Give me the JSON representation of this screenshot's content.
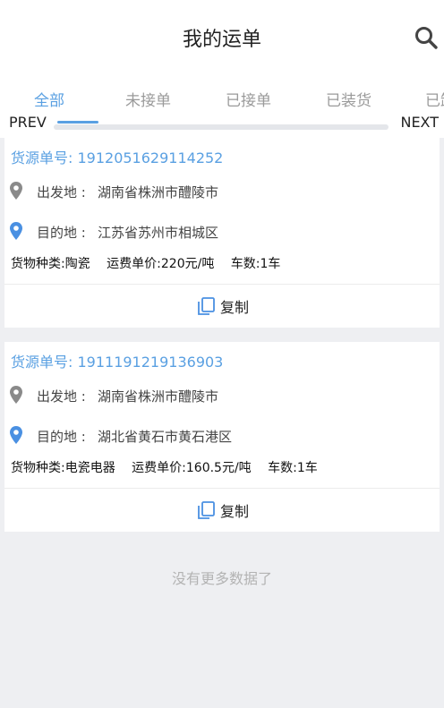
{
  "header": {
    "title": "我的运单"
  },
  "tabs": [
    {
      "label": "全部",
      "active": true
    },
    {
      "label": "未接单",
      "active": false
    },
    {
      "label": "已接单",
      "active": false
    },
    {
      "label": "已装货",
      "active": false
    },
    {
      "label": "已卸",
      "active": false
    }
  ],
  "nav": {
    "prev": "PREV",
    "next": "NEXT"
  },
  "orders": [
    {
      "order_no": "货源单号: 1912051629114252",
      "from_label": "出发地 :",
      "from_value": "湖南省株洲市醴陵市",
      "to_label": "目的地 :",
      "to_value": "江苏省苏州市相城区",
      "cargo_type": "货物种类:陶瓷",
      "unit_price": "运费单价:220元/吨",
      "truck_count": "车数:1车",
      "copy_label": "复制"
    },
    {
      "order_no": "货源单号: 1911191219136903",
      "from_label": "出发地 :",
      "from_value": "湖南省株洲市醴陵市",
      "to_label": "目的地 :",
      "to_value": "湖北省黄石市黄石港区",
      "cargo_type": "货物种类:电瓷电器",
      "unit_price": "运费单价:160.5元/吨",
      "truck_count": "车数:1车",
      "copy_label": "复制"
    }
  ],
  "footer": {
    "no_more": "没有更多数据了"
  },
  "colors": {
    "accent": "#5aa0e2",
    "origin_pin": "#8a8a8a",
    "destination_pin": "#4a90e2",
    "background": "#eeeff2"
  },
  "icons": {
    "search": "search-icon",
    "origin": "origin-pin-icon",
    "destination": "destination-pin-icon",
    "copy": "copy-icon"
  }
}
